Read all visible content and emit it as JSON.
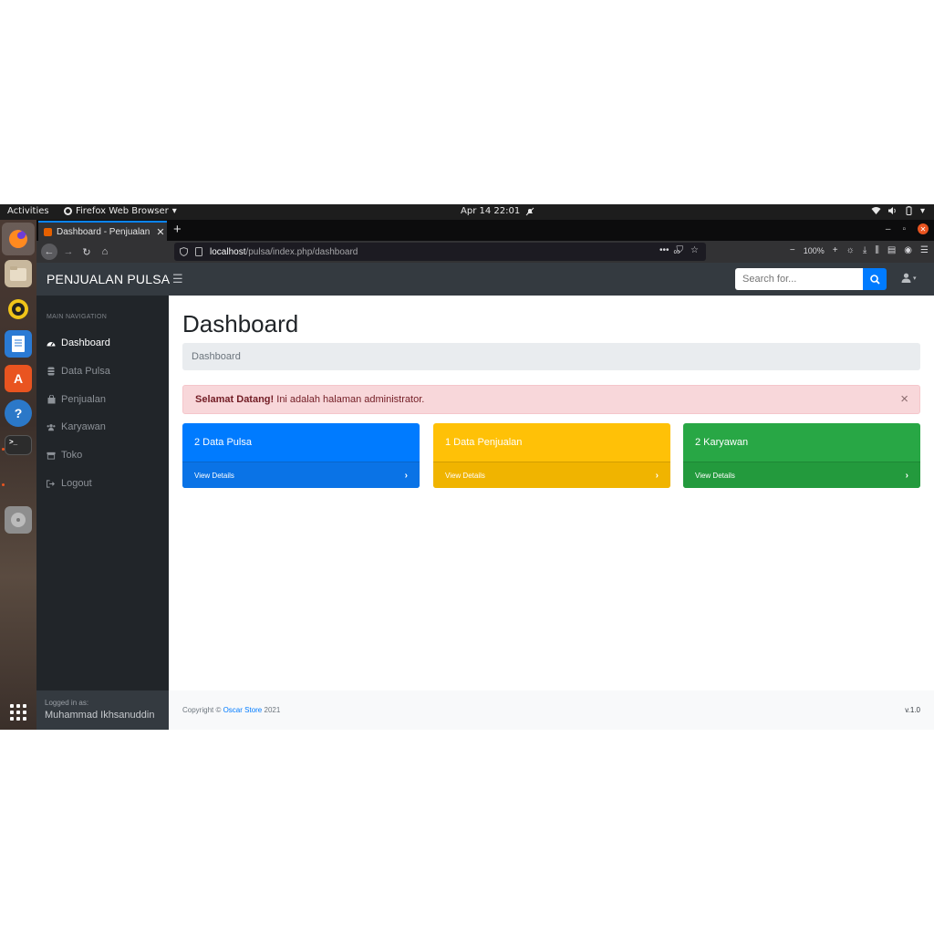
{
  "os": {
    "activities": "Activities",
    "app_name": "Firefox Web Browser",
    "clock": "Apr 14  22:01"
  },
  "browser": {
    "tab_title": "Dashboard - Penjualan Pulsa",
    "url_host": "localhost",
    "url_path": "/pulsa/index.php/dashboard",
    "zoom": "100%"
  },
  "app": {
    "brand": "PENJUALAN PULSA",
    "search_placeholder": "Search for..."
  },
  "sidebar": {
    "heading": "MAIN NAVIGATION",
    "items": [
      {
        "label": "Dashboard",
        "icon": "tachometer-icon"
      },
      {
        "label": "Data Pulsa",
        "icon": "database-icon"
      },
      {
        "label": "Penjualan",
        "icon": "shopping-bag-icon"
      },
      {
        "label": "Karyawan",
        "icon": "users-icon"
      },
      {
        "label": "Toko",
        "icon": "store-icon"
      },
      {
        "label": "Logout",
        "icon": "sign-out-icon"
      }
    ],
    "logged_label": "Logged in as:",
    "user": "Muhammad Ikhsanuddin"
  },
  "main": {
    "title": "Dashboard",
    "breadcrumb": "Dashboard",
    "alert_strong": "Selamat Datang!",
    "alert_text": " Ini adalah halaman administrator.",
    "cards": [
      {
        "label": "2 Data Pulsa",
        "footer": "View Details",
        "color": "#007bff"
      },
      {
        "label": "1 Data Penjualan",
        "footer": "View Details",
        "color": "#ffc107"
      },
      {
        "label": "2 Karyawan",
        "footer": "View Details",
        "color": "#28a745"
      }
    ]
  },
  "footer": {
    "copy_prefix": "Copyright © ",
    "copy_link": "Oscar Store",
    "copy_suffix": " 2021",
    "version": "v.1.0"
  }
}
